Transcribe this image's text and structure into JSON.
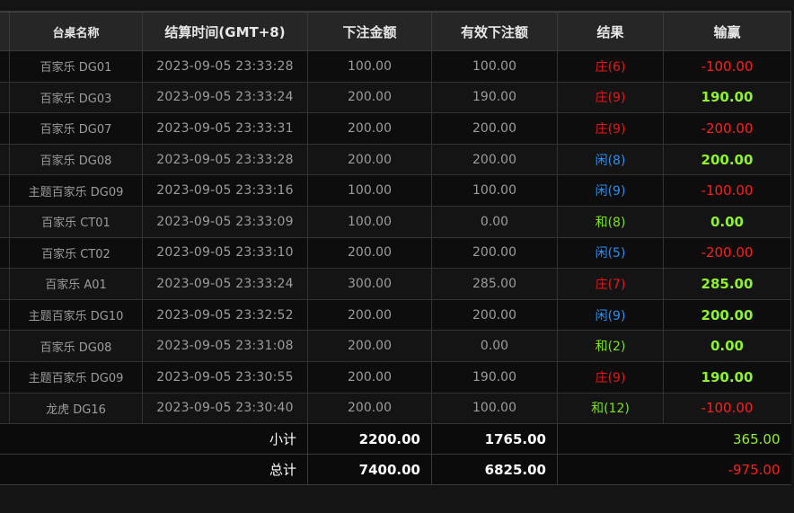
{
  "headers": {
    "table": "台桌名称",
    "time": "结算时间(GMT+8)",
    "bet": "下注金额",
    "valid": "有效下注额",
    "result": "结果",
    "winloss": "输赢"
  },
  "rows": [
    {
      "table": "百家乐 DG01",
      "time": "2023-09-05 23:33:28",
      "bet": "100.00",
      "valid": "100.00",
      "result": "庄(6)",
      "result_color": "red",
      "winloss": "-100.00",
      "wl": "loss"
    },
    {
      "table": "百家乐 DG03",
      "time": "2023-09-05 23:33:24",
      "bet": "200.00",
      "valid": "190.00",
      "result": "庄(9)",
      "result_color": "red",
      "winloss": "190.00",
      "wl": "win"
    },
    {
      "table": "百家乐 DG07",
      "time": "2023-09-05 23:33:31",
      "bet": "200.00",
      "valid": "200.00",
      "result": "庄(9)",
      "result_color": "red",
      "winloss": "-200.00",
      "wl": "loss"
    },
    {
      "table": "百家乐 DG08",
      "time": "2023-09-05 23:33:28",
      "bet": "200.00",
      "valid": "200.00",
      "result": "闲(8)",
      "result_color": "blue",
      "winloss": "200.00",
      "wl": "win"
    },
    {
      "table": "主题百家乐 DG09",
      "time": "2023-09-05 23:33:16",
      "bet": "100.00",
      "valid": "100.00",
      "result": "闲(9)",
      "result_color": "blue",
      "winloss": "-100.00",
      "wl": "loss"
    },
    {
      "table": "百家乐 CT01",
      "time": "2023-09-05 23:33:09",
      "bet": "100.00",
      "valid": "0.00",
      "result": "和(8)",
      "result_color": "green",
      "winloss": "0.00",
      "wl": "win"
    },
    {
      "table": "百家乐 CT02",
      "time": "2023-09-05 23:33:10",
      "bet": "200.00",
      "valid": "200.00",
      "result": "闲(5)",
      "result_color": "blue",
      "winloss": "-200.00",
      "wl": "loss"
    },
    {
      "table": "百家乐 A01",
      "time": "2023-09-05 23:33:24",
      "bet": "300.00",
      "valid": "285.00",
      "result": "庄(7)",
      "result_color": "red",
      "winloss": "285.00",
      "wl": "win"
    },
    {
      "table": "主题百家乐 DG10",
      "time": "2023-09-05 23:32:52",
      "bet": "200.00",
      "valid": "200.00",
      "result": "闲(9)",
      "result_color": "blue",
      "winloss": "200.00",
      "wl": "win"
    },
    {
      "table": "百家乐 DG08",
      "time": "2023-09-05 23:31:08",
      "bet": "200.00",
      "valid": "0.00",
      "result": "和(2)",
      "result_color": "green",
      "winloss": "0.00",
      "wl": "win"
    },
    {
      "table": "主题百家乐 DG09",
      "time": "2023-09-05 23:30:55",
      "bet": "200.00",
      "valid": "190.00",
      "result": "庄(9)",
      "result_color": "red",
      "winloss": "190.00",
      "wl": "win"
    },
    {
      "table": "龙虎 DG16",
      "time": "2023-09-05 23:30:40",
      "bet": "200.00",
      "valid": "100.00",
      "result": "和(12)",
      "result_color": "green",
      "winloss": "-100.00",
      "wl": "loss"
    }
  ],
  "subtotal": {
    "label": "小计",
    "bet": "2200.00",
    "valid": "1765.00",
    "winloss": "365.00"
  },
  "total": {
    "label": "总计",
    "bet": "7400.00",
    "valid": "6825.00",
    "winloss": "-975.00"
  },
  "colors": {
    "banker": "#e8161c",
    "player": "#2d8ff0",
    "tie": "#7ee01e",
    "win": "#8ef22d",
    "loss": "#ff1f1f"
  }
}
